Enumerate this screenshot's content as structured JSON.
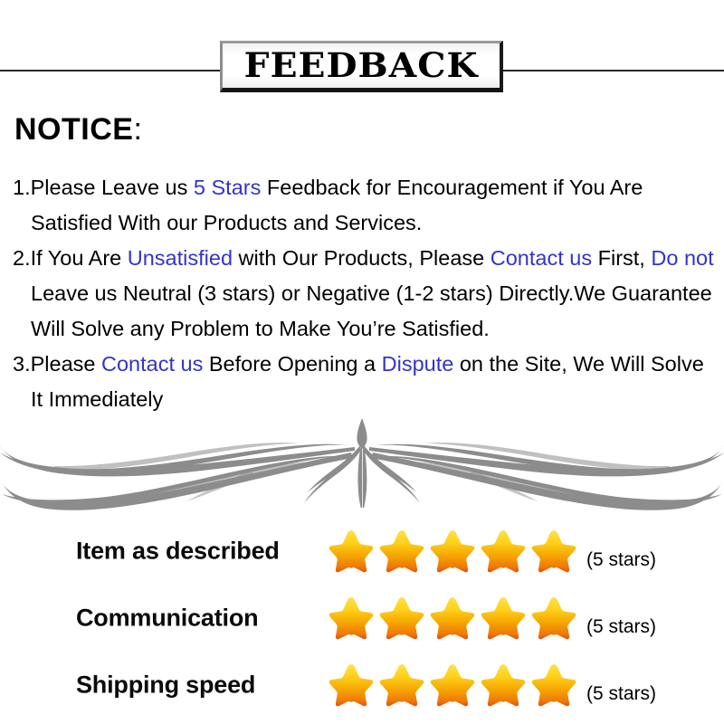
{
  "banner": {
    "title": "FEEDBACK"
  },
  "notice": {
    "heading_word": "NOTICE",
    "heading_colon": ":",
    "items": [
      {
        "number": "1.",
        "segments": [
          {
            "text": "Please Leave us ",
            "style": "normal"
          },
          {
            "text": " 5 Stars ",
            "style": "highlight"
          },
          {
            "text": " Feedback for  Encouragement  if You Are",
            "style": "normal"
          }
        ],
        "continuation": [
          "Satisfied With our Products and Services."
        ]
      },
      {
        "number": "2.",
        "segments": [
          {
            "text": "If You Are ",
            "style": "normal"
          },
          {
            "text": "Unsatisfied",
            "style": "highlight"
          },
          {
            "text": " with Our Products, Please ",
            "style": "normal"
          },
          {
            "text": "Contact us",
            "style": "highlight"
          },
          {
            "text": " First, ",
            "style": "normal"
          },
          {
            "text": "Do not",
            "style": "highlight"
          }
        ],
        "continuation": [
          "Leave us Neutral (3 stars) or Negative (1-2 stars) Directly.We Guarantee",
          "Will Solve any Problem to Make You’re  Satisfied."
        ]
      },
      {
        "number": "3.",
        "segments": [
          {
            "text": "Please ",
            "style": "normal"
          },
          {
            "text": "Contact us",
            "style": "highlight"
          },
          {
            "text": " Before Opening a ",
            "style": "normal"
          },
          {
            "text": "Dispute",
            "style": "highlight"
          },
          {
            "text": " on the Site, We Will Solve",
            "style": "normal"
          }
        ],
        "continuation": [
          "It Immediately"
        ]
      }
    ]
  },
  "ratings": {
    "rows": [
      {
        "label": "Item as described",
        "stars": 5,
        "count_label": "(5 stars)"
      },
      {
        "label": "Communication",
        "stars": 5,
        "count_label": "(5 stars)"
      },
      {
        "label": "Shipping speed",
        "stars": 5,
        "count_label": "(5 stars)"
      }
    ]
  },
  "colors": {
    "highlight": "#3333cc",
    "text": "#000000",
    "ornament": "#8c8c8c",
    "star_top": "#ffd42a",
    "star_mid": "#f5a800",
    "star_bottom": "#e05a10"
  }
}
